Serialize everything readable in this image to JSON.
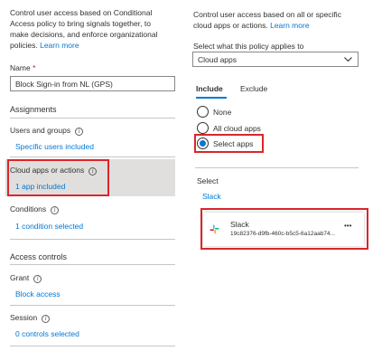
{
  "left": {
    "intro": "Control user access based on Conditional Access policy to bring signals together, to make decisions, and enforce organizational policies.",
    "intro_lines": [
      "Control user access based on Conditional",
      "Access policy to bring signals together, to",
      "make decisions, and enforce organizational"
    ],
    "intro_last": "policies.",
    "learn_more": "Learn more",
    "name_label": "Name",
    "required_mark": "*",
    "name_value": "Block Sign-in from NL (GPS)",
    "assignments_heading": "Assignments",
    "users_label": "Users and groups",
    "users_link": "Specific users included",
    "cloud_label": "Cloud apps or actions",
    "cloud_link": "1 app included",
    "conditions_label": "Conditions",
    "conditions_link": "1 condition selected",
    "access_heading": "Access controls",
    "grant_label": "Grant",
    "grant_link": "Block access",
    "session_label": "Session",
    "session_link": "0 controls selected"
  },
  "right": {
    "intro_line1": "Control user access based on all or specific",
    "intro_line2": "cloud apps or actions.",
    "learn_more": "Learn more",
    "applies_label": "Select what this policy applies to",
    "applies_value": "Cloud apps",
    "tabs": [
      {
        "label": "Include",
        "active": true
      },
      {
        "label": "Exclude",
        "active": false
      }
    ],
    "radios": [
      {
        "label": "None",
        "checked": false
      },
      {
        "label": "All cloud apps",
        "checked": false
      },
      {
        "label": "Select apps",
        "checked": true
      }
    ],
    "select_heading": "Select",
    "select_link": "Slack",
    "app": {
      "name": "Slack",
      "id": "19c82376-d9fb-460c-b5c5-6a12aab74...",
      "more": "•••"
    }
  },
  "colors": {
    "link": "#0078d4",
    "highlight_red": "#d9262a",
    "selected_row_bg": "#e1dfdd"
  },
  "icons": [
    "info-icon",
    "chevron-down-icon",
    "slack-logo-icon",
    "more-icon"
  ]
}
